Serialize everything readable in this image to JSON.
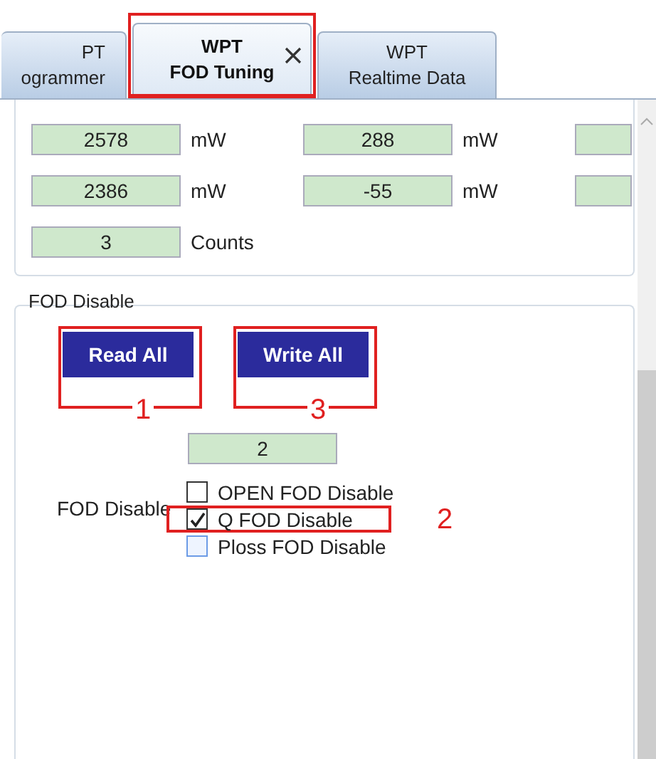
{
  "tabs": [
    {
      "line1": "PT",
      "line2": "ogrammer",
      "selected": false,
      "closable": false,
      "annotated": false
    },
    {
      "line1": "WPT",
      "line2": "FOD Tuning",
      "selected": true,
      "closable": true,
      "annotated": true
    },
    {
      "line1": "WPT",
      "line2": "Realtime Data",
      "selected": false,
      "closable": false,
      "annotated": false
    }
  ],
  "readings": [
    {
      "cells": [
        {
          "kind": "value",
          "value": "2578",
          "unit": "mW"
        },
        {
          "kind": "value",
          "value": "288",
          "unit": "mW"
        },
        {
          "kind": "clipped"
        }
      ]
    },
    {
      "cells": [
        {
          "kind": "value",
          "value": "2386",
          "unit": "mW"
        },
        {
          "kind": "value",
          "value": "-55",
          "unit": "mW"
        },
        {
          "kind": "clipped"
        }
      ]
    },
    {
      "cells": [
        {
          "kind": "value",
          "value": "3",
          "unit": "Counts"
        }
      ]
    }
  ],
  "fod_disable": {
    "title": "FOD Disable",
    "buttons": [
      {
        "label": "Read All",
        "annotation": "1"
      },
      {
        "label": "Write All",
        "annotation": "3"
      }
    ],
    "value": "2",
    "label": "FOD Disable",
    "options": [
      {
        "label": "OPEN FOD Disable",
        "checked": false,
        "hovered": false
      },
      {
        "label": "Q FOD Disable",
        "checked": true,
        "hovered": false,
        "annotation": "2"
      },
      {
        "label": "Ploss FOD Disable",
        "checked": false,
        "hovered": true
      }
    ]
  }
}
